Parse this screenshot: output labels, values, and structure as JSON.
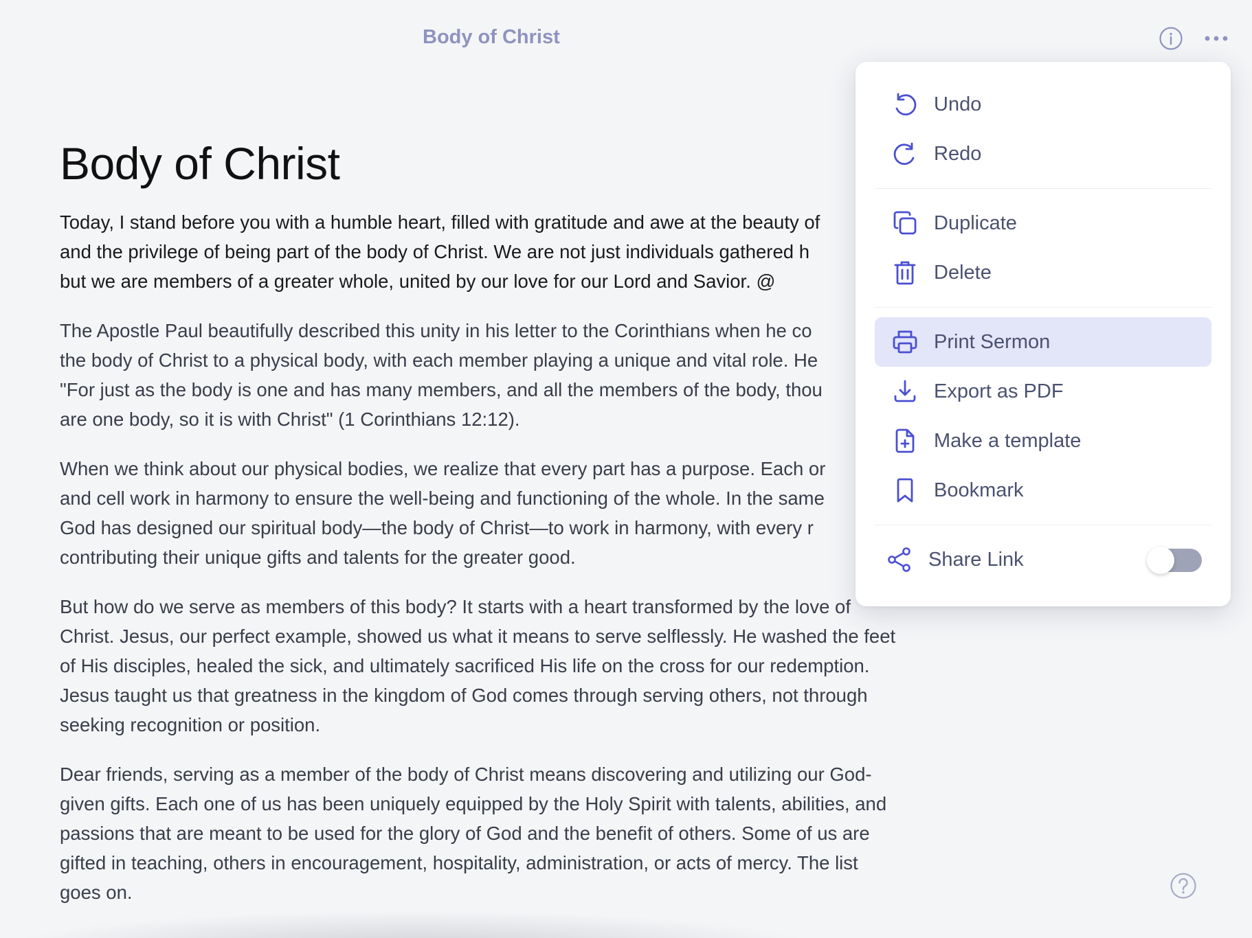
{
  "header": {
    "title": "Body of Christ",
    "info_icon": "info-circle-icon",
    "more_icon": "more-horizontal-icon"
  },
  "document": {
    "title": "Body of Christ",
    "paragraphs": [
      {
        "lines": [
          "Today, I stand before you with a humble heart, filled with gratitude and awe at the beauty of",
          "and the privilege of being part of the body of Christ. We are not just individuals gathered h",
          "but we are members of a greater whole, united by our love for our Lord and Savior. @"
        ]
      },
      {
        "lines": [
          "The Apostle Paul beautifully described this unity in his letter to the Corinthians when he co",
          "the body of Christ to a physical body, with each member playing a unique and vital role. He",
          "\"For just as the body is one and has many members, and all the members of the body, thou",
          "are one body, so it is with Christ\" (1 Corinthians 12:12)."
        ]
      },
      {
        "lines": [
          "When we think about our physical bodies, we realize that every part has a purpose. Each or",
          "and cell work in harmony to ensure the well-being and functioning of the whole. In the same",
          "God has designed our spiritual body—the body of Christ—to work in harmony, with every r",
          "contributing their unique gifts and talents for the greater good."
        ]
      },
      {
        "lines": [
          "But how do we serve as members of this body? It starts with a heart transformed by the love of",
          "Christ. Jesus, our perfect example, showed us what it means to serve selflessly. He washed the feet",
          "of His disciples, healed the sick, and ultimately sacrificed His life on the cross for our redemption.",
          "Jesus taught us that greatness in the kingdom of God comes through serving others, not through",
          "seeking recognition or position."
        ]
      },
      {
        "lines": [
          "Dear friends, serving as a member of the body of Christ means discovering and utilizing our God-",
          "given gifts. Each one of us has been uniquely equipped by the Holy Spirit with talents, abilities, and",
          "passions that are meant to be used for the glory of God and the benefit of others. Some of us are",
          "gifted in teaching, others in encouragement, hospitality, administration, or acts of mercy. The list",
          "goes on."
        ]
      }
    ]
  },
  "menu": {
    "undo": "Undo",
    "redo": "Redo",
    "duplicate": "Duplicate",
    "delete": "Delete",
    "print_sermon": "Print Sermon",
    "export_pdf": "Export as PDF",
    "make_template": "Make a template",
    "bookmark": "Bookmark",
    "share_link": "Share Link",
    "share_link_enabled": false
  },
  "colors": {
    "accent": "#4a4fd1",
    "menu_text": "#4b5170",
    "active_bg": "#e3e5f8",
    "header_title": "#8e93c0"
  },
  "help_icon": "help-circle-icon"
}
